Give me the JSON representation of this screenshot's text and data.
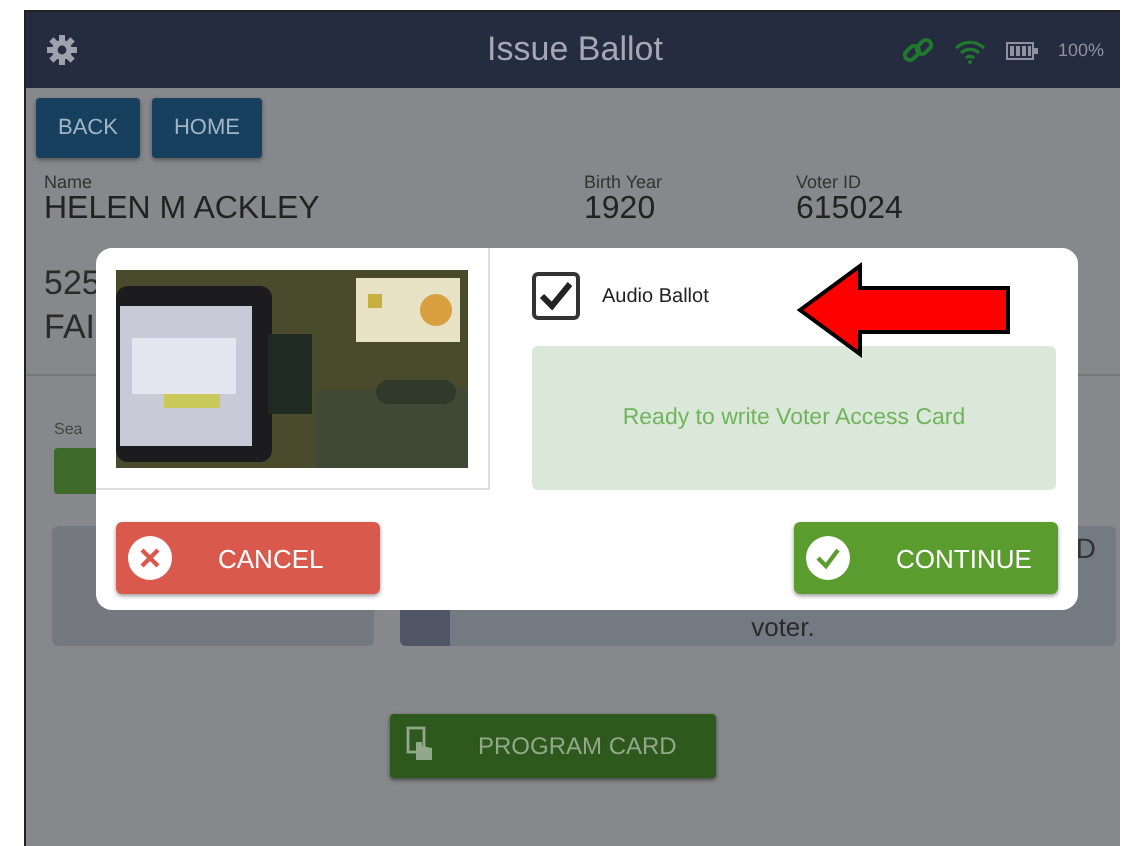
{
  "header": {
    "title": "Issue Ballot",
    "battery": "100%"
  },
  "nav_buttons": [
    "BACK",
    "HOME"
  ],
  "voter_fields": [
    {
      "label": "Name",
      "value": "HELEN M ACKLEY"
    },
    {
      "label": "Birth Year",
      "value": "1920"
    },
    {
      "label": "Voter ID",
      "value": "615024"
    }
  ],
  "address_lines": [
    "525",
    "FAI"
  ],
  "search_label": "Sea",
  "status_panel": {
    "text_1": "D",
    "text_2": "voter."
  },
  "program_button": "PROGRAM CARD",
  "dialog": {
    "checkbox": {
      "label": "Audio Ballot",
      "checked": true
    },
    "message": "Ready to write Voter Access Card",
    "buttons": [
      {
        "label": "CANCEL",
        "kind": "cancel"
      },
      {
        "label": "CONTINUE",
        "kind": "continue"
      }
    ]
  }
}
